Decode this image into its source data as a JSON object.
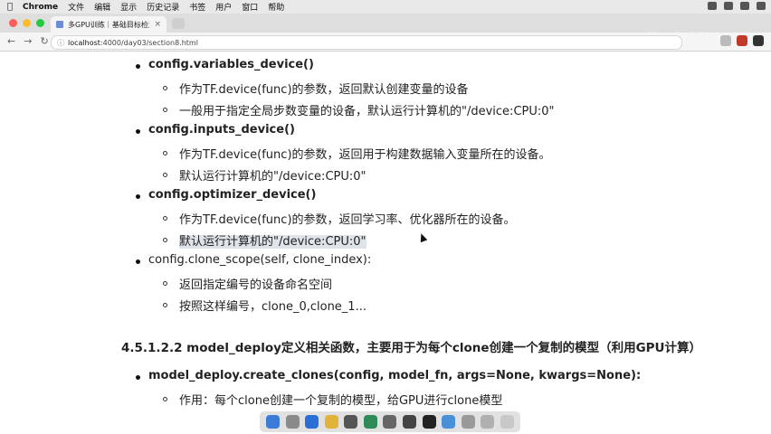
{
  "menubar": {
    "app_name": "Chrome",
    "items": [
      "文件",
      "编辑",
      "显示",
      "历史记录",
      "书签",
      "用户",
      "窗口",
      "帮助"
    ]
  },
  "tab": {
    "title": "多GPU训练｜基础目标检测课件"
  },
  "watermark": "AI学习人在路上",
  "address": {
    "host": "localhost",
    "path": ":4000/day03/section8.html"
  },
  "content": {
    "items": [
      {
        "name": "config.variables_device()",
        "subs": [
          "作为TF.device(func)的参数，返回默认创建变量的设备",
          "一般用于指定全局步数变量的设备，默认运行计算机的\"/device:CPU:0\""
        ]
      },
      {
        "name": "config.inputs_device()",
        "subs": [
          "作为TF.device(func)的参数，返回用于构建数据输入变量所在的设备。",
          "默认运行计算机的\"/device:CPU:0\""
        ]
      },
      {
        "name": "config.optimizer_device()",
        "subs": [
          "作为TF.device(func)的参数，返回学习率、优化器所在的设备。",
          "默认运行计算机的\"/device:CPU:0\""
        ]
      },
      {
        "name": "config.clone_scope(self, clone_index):",
        "subs": [
          "返回指定编号的设备命名空间",
          "按照这样编号，clone_0,clone_1..."
        ]
      }
    ],
    "section_heading": "4.5.1.2.2 model_deploy定义相关函数，主要用于为每个clone创建一个复制的模型（利用GPU计算）",
    "create_clones": {
      "name": "model_deploy.create_clones(config, model_fn, args=None, kwargs=None):",
      "subs": [
        "作用：每个clone创建一个复制的模型，给GPU进行clone模型"
      ]
    }
  },
  "colors": {
    "menubar_bg": "#e9e9e9",
    "tabstrip_bg": "#dedede",
    "highlight": "#dfe3ea"
  }
}
